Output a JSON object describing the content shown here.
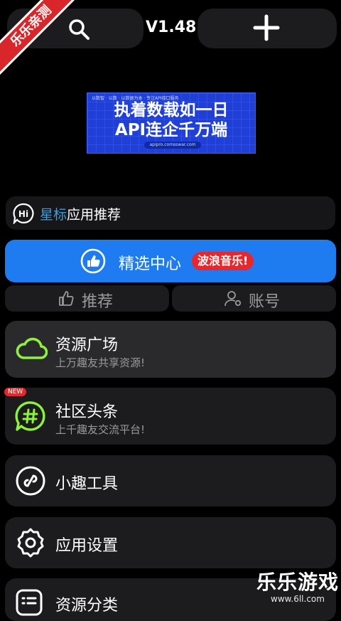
{
  "top": {
    "version": "V1.48",
    "ribbon": "乐乐亲测"
  },
  "banner": {
    "top_text": "以数智 · 以数 · 以数据为本 · 专注API接口服务",
    "line1": "执着数载如一日",
    "line2": "API连企千万端",
    "url": "apipro.comsswar.com"
  },
  "recommend": {
    "star": "星标",
    "text": "应用推荐"
  },
  "featured": {
    "label": "精选中心",
    "badge": "波浪音乐!"
  },
  "tabs": {
    "recommend": "推荐",
    "account": "账号"
  },
  "cards": {
    "resource": {
      "title": "资源广场",
      "sub": "上万趣友共享资源!"
    },
    "community": {
      "title": "社区头条",
      "sub": "上千趣友交流平台!",
      "badge": "NEW"
    },
    "tools": {
      "title": "小趣工具"
    },
    "settings": {
      "title": "应用设置"
    },
    "category": {
      "title": "资源分类"
    }
  },
  "watermark": {
    "title": "乐乐游戏",
    "url": "www.6ll.com"
  },
  "colors": {
    "accent_blue": "#1e7cf0",
    "badge_red": "#e8262b",
    "cloud_green": "#8cf23a",
    "star_blue": "#3a9ee0"
  }
}
